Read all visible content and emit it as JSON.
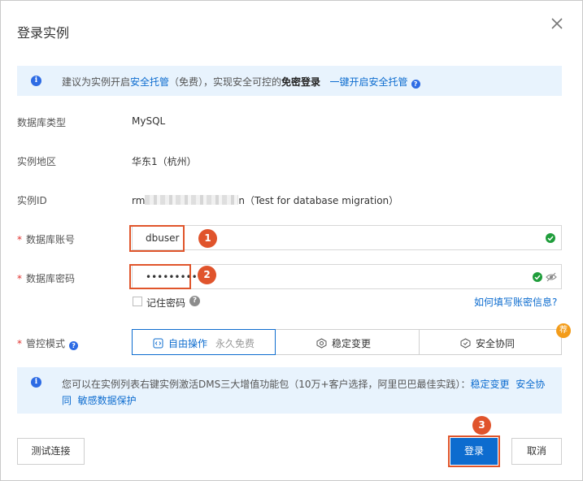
{
  "dialog": {
    "title": "登录实例",
    "close_label": "×"
  },
  "tip_top": {
    "text_1": "建议为实例开启",
    "link_1": "安全托管",
    "text_2": "（免费），实现安全可控的",
    "bold": "免密登录",
    "link_2": "一键开启安全托管"
  },
  "info": {
    "db_type_label": "数据库类型",
    "db_type_value": "MySQL",
    "region_label": "实例地区",
    "region_value": "华东1（杭州）",
    "instance_id_label": "实例ID",
    "instance_id_prefix": "rm",
    "instance_id_suffix": "n（Test for database migration）"
  },
  "form": {
    "account_label": "数据库账号",
    "account_value": "dbuser",
    "password_label": "数据库密码",
    "password_value": "•••••••••••",
    "remember_label": "记住密码",
    "howto_link": "如何填写账密信息?",
    "mode_label": "管控模式"
  },
  "modes": [
    {
      "label": "自由操作",
      "sub": "永久免费",
      "active": true
    },
    {
      "label": "稳定变更",
      "sub": "",
      "active": false
    },
    {
      "label": "安全协同",
      "sub": "",
      "active": false
    }
  ],
  "recommend_badge": "荐",
  "tip_bottom": {
    "text": "您可以在实例列表右键实例激活DMS三大增值功能包（10万+客户选择，阿里巴巴最佳实践）：",
    "link_1": "稳定变更",
    "link_2": "安全协同",
    "link_3": "敏感数据保护"
  },
  "buttons": {
    "test": "测试连接",
    "login": "登录",
    "cancel": "取消"
  },
  "steps": [
    "1",
    "2",
    "3"
  ],
  "colors": {
    "primary": "#0d6ccf",
    "highlight": "#e0552b",
    "success": "#1f9d3b",
    "tip_bg": "#e8f3fd",
    "badge": "#f39c1a"
  }
}
